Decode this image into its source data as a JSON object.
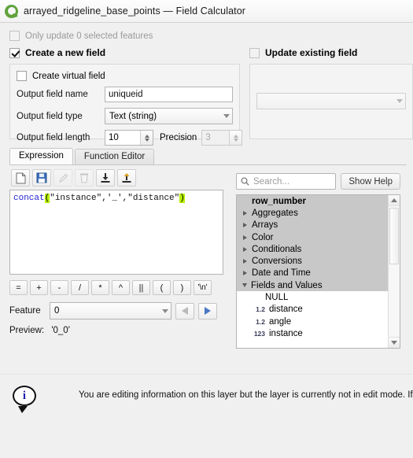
{
  "window": {
    "title": "arrayed_ridgeline_base_points — Field Calculator",
    "logo_icon": "qgis-logo-icon"
  },
  "options": {
    "only_update_selected": {
      "label": "Only update 0 selected features",
      "checked": false,
      "enabled": false
    },
    "create_new_field": {
      "label": "Create a new field",
      "checked": true,
      "enabled": true
    },
    "update_existing_field": {
      "label": "Update existing field",
      "checked": false,
      "enabled": false
    },
    "existing_field_value": ""
  },
  "new_field": {
    "virtual_field": {
      "label": "Create virtual field",
      "checked": false
    },
    "name_label": "Output field name",
    "name_value": "uniqueid",
    "type_label": "Output field type",
    "type_value": "Text (string)",
    "length_label": "Output field length",
    "length_value": "10",
    "precision_label": "Precision",
    "precision_value": "3"
  },
  "tabs": [
    {
      "label": "Expression",
      "active": true
    },
    {
      "label": "Function Editor",
      "active": false
    }
  ],
  "expression_toolbar": [
    {
      "icon": "new-file-icon",
      "enabled": true
    },
    {
      "icon": "save-icon",
      "enabled": true
    },
    {
      "icon": "edit-pencil-icon",
      "enabled": false
    },
    {
      "icon": "delete-trash-icon",
      "enabled": false
    },
    {
      "icon": "import-icon",
      "enabled": true
    },
    {
      "icon": "export-icon",
      "enabled": true
    }
  ],
  "expression": {
    "function_name": "concat",
    "open_paren": "(",
    "args": "\"instance\",'_',\"distance\"",
    "close_paren": ")",
    "full_text": "concat(\"instance\",'_',\"distance\")"
  },
  "operators": [
    "=",
    "+",
    "-",
    "/",
    "*",
    "^",
    "||",
    "(",
    ")",
    "'\\n'"
  ],
  "feature": {
    "label": "Feature",
    "value": "0",
    "prev_enabled": false,
    "next_enabled": true
  },
  "preview": {
    "label": "Preview:",
    "value": "'0_0'"
  },
  "function_panel": {
    "search_placeholder": "Search...",
    "search_icon": "search-icon",
    "show_help_label": "Show Help",
    "tree": [
      {
        "label": "row_number",
        "kind": "header",
        "indent": 0
      },
      {
        "label": "Aggregates",
        "kind": "group",
        "expanded": false,
        "indent": 0
      },
      {
        "label": "Arrays",
        "kind": "group",
        "expanded": false,
        "indent": 0
      },
      {
        "label": "Color",
        "kind": "group",
        "expanded": false,
        "indent": 0
      },
      {
        "label": "Conditionals",
        "kind": "group",
        "expanded": false,
        "indent": 0
      },
      {
        "label": "Conversions",
        "kind": "group",
        "expanded": false,
        "indent": 0
      },
      {
        "label": "Date and Time",
        "kind": "group",
        "expanded": false,
        "indent": 0
      },
      {
        "label": "Fields and Values",
        "kind": "group",
        "expanded": true,
        "indent": 0
      },
      {
        "label": "NULL",
        "kind": "child",
        "type": "",
        "indent": 1
      },
      {
        "label": "distance",
        "kind": "child",
        "type": "1.2",
        "indent": 1
      },
      {
        "label": "angle",
        "kind": "child",
        "type": "1.2",
        "indent": 1
      },
      {
        "label": "instance",
        "kind": "child",
        "type": "123",
        "indent": 1
      }
    ]
  },
  "footer": {
    "icon": "info-icon",
    "icon_glyph": "i",
    "message": "You are editing information on this layer but the layer is currently not in edit mode. If you cli"
  },
  "colors": {
    "accent_blue": "#4a79c4",
    "qgis_green": "#5fa33c",
    "bracket_highlight": "#b7f000",
    "function_blue": "#2222cc",
    "info_blue": "#1f1fae"
  }
}
